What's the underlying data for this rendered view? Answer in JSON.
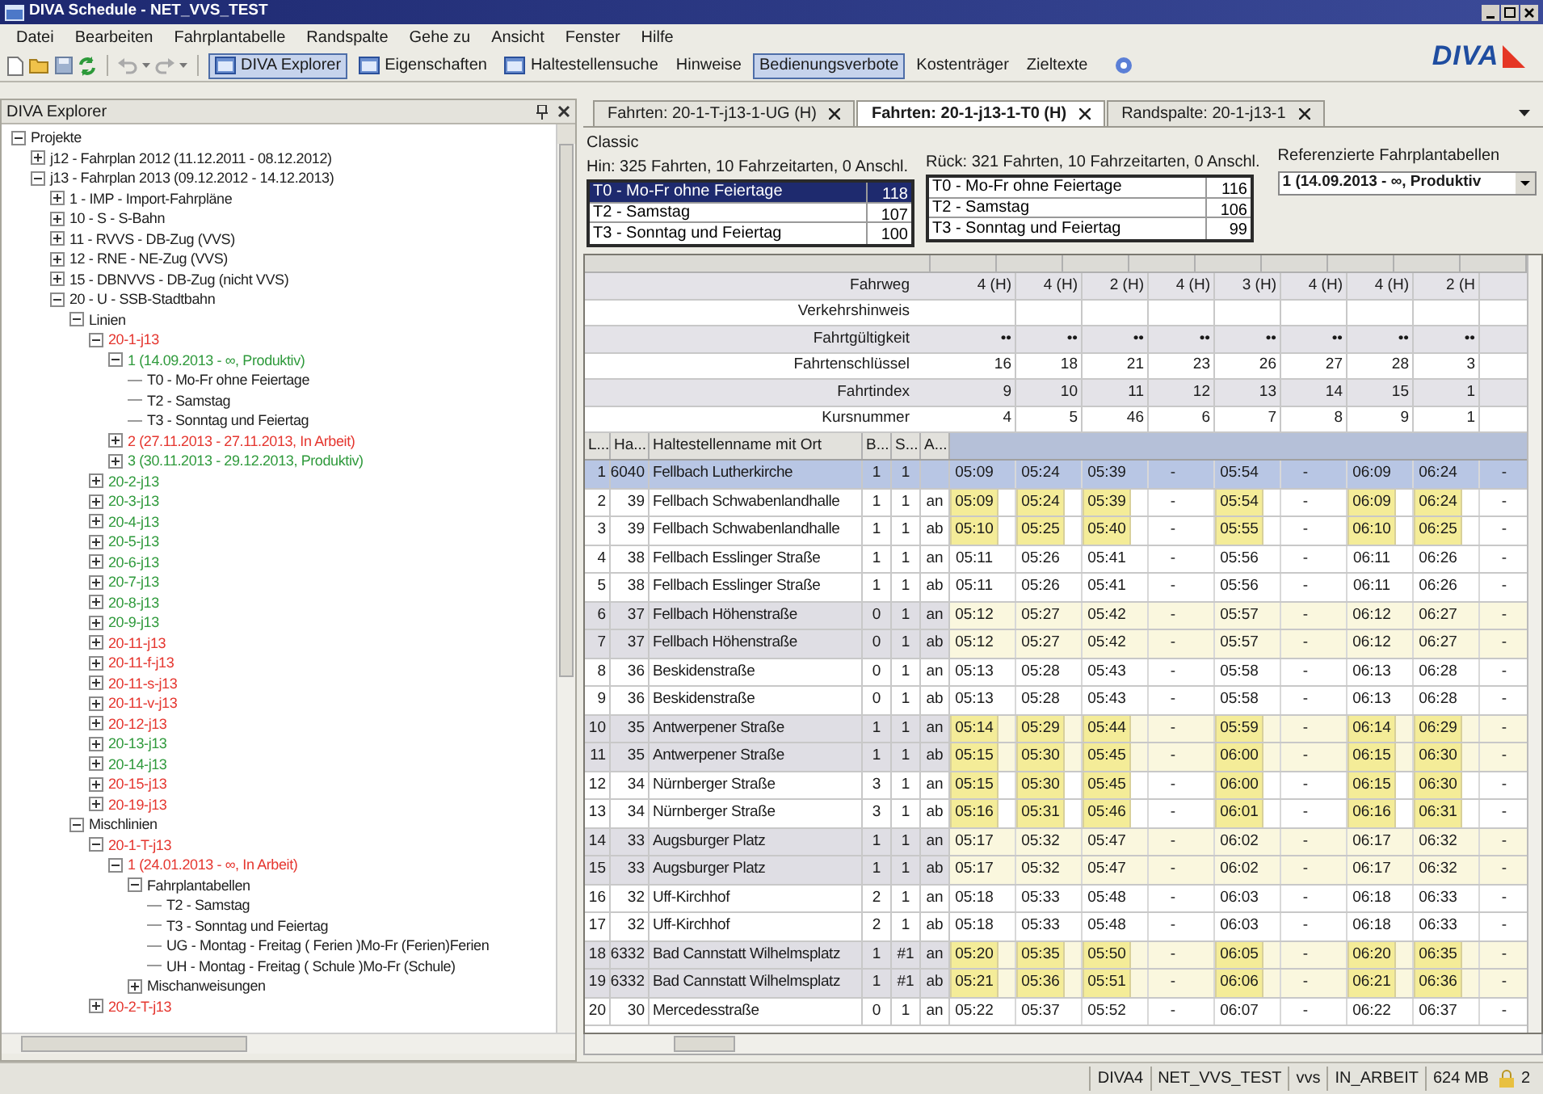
{
  "window": {
    "title": "DIVA Schedule - NET_VVS_TEST"
  },
  "menu": [
    "Datei",
    "Bearbeiten",
    "Fahrplantabelle",
    "Randspalte",
    "Gehe zu",
    "Ansicht",
    "Fenster",
    "Hilfe"
  ],
  "logo": {
    "text": "DIVA"
  },
  "toolbar": [
    {
      "label": "DIVA Explorer",
      "kind": "icon-text",
      "on": true
    },
    {
      "label": "Eigenschaften",
      "kind": "icon-text",
      "on": false
    },
    {
      "label": "Haltestellensuche",
      "kind": "icon-text",
      "on": false
    },
    {
      "label": "Hinweise",
      "kind": "text",
      "on": false
    },
    {
      "label": "Bedienungsverbote",
      "kind": "text",
      "on": true
    },
    {
      "label": "Kostenträger",
      "kind": "text",
      "on": false
    },
    {
      "label": "Zieltexte",
      "kind": "text",
      "on": false
    }
  ],
  "explorer": {
    "title": "DIVA Explorer",
    "tree": [
      {
        "label": "Projekte",
        "color": "#1e1e1e",
        "expanded": true,
        "children": [
          {
            "label": "j12 - Fahrplan 2012 (11.12.2011 - 08.12.2012)",
            "color": "#1e1e1e",
            "expanded": false
          },
          {
            "label": "j13 - Fahrplan 2013 (09.12.2012 - 14.12.2013)",
            "color": "#1e1e1e",
            "expanded": true,
            "children": [
              {
                "label": "1 - IMP - Import-Fahrpläne",
                "color": "#1e1e1e",
                "expanded": false
              },
              {
                "label": "10 - S - S-Bahn",
                "color": "#1e1e1e",
                "expanded": false
              },
              {
                "label": "11 - RVVS - DB-Zug  (VVS)",
                "color": "#1e1e1e",
                "expanded": false
              },
              {
                "label": "12 - RNE - NE-Zug (VVS)",
                "color": "#1e1e1e",
                "expanded": false
              },
              {
                "label": "15 - DBNVVS - DB-Zug  (nicht VVS)",
                "color": "#1e1e1e",
                "expanded": false
              },
              {
                "label": "20 - U - SSB-Stadtbahn",
                "color": "#1e1e1e",
                "expanded": true,
                "children": [
                  {
                    "label": "Linien",
                    "color": "#1e1e1e",
                    "expanded": true,
                    "children": [
                      {
                        "label": "20-1-j13",
                        "color": "#e5362f",
                        "expanded": true,
                        "children": [
                          {
                            "label": "1 (14.09.2013 - ∞, Produktiv)",
                            "color": "#2f9a3c",
                            "expanded": true,
                            "children": [
                              {
                                "label": "T0 - Mo-Fr ohne Feiertage",
                                "color": "#1e1e1e"
                              },
                              {
                                "label": "T2 - Samstag",
                                "color": "#1e1e1e"
                              },
                              {
                                "label": "T3 - Sonntag und Feiertag",
                                "color": "#1e1e1e"
                              }
                            ]
                          },
                          {
                            "label": "2 (27.11.2013 - 27.11.2013, In Arbeit)",
                            "color": "#e5362f",
                            "expanded": false
                          },
                          {
                            "label": "3 (30.11.2013 - 29.12.2013, Produktiv)",
                            "color": "#2f9a3c",
                            "expanded": false
                          }
                        ]
                      },
                      {
                        "label": "20-2-j13",
                        "color": "#2f9a3c",
                        "expanded": false
                      },
                      {
                        "label": "20-3-j13",
                        "color": "#2f9a3c",
                        "expanded": false
                      },
                      {
                        "label": "20-4-j13",
                        "color": "#2f9a3c",
                        "expanded": false
                      },
                      {
                        "label": "20-5-j13",
                        "color": "#2f9a3c",
                        "expanded": false
                      },
                      {
                        "label": "20-6-j13",
                        "color": "#2f9a3c",
                        "expanded": false
                      },
                      {
                        "label": "20-7-j13",
                        "color": "#2f9a3c",
                        "expanded": false
                      },
                      {
                        "label": "20-8-j13",
                        "color": "#2f9a3c",
                        "expanded": false
                      },
                      {
                        "label": "20-9-j13",
                        "color": "#2f9a3c",
                        "expanded": false
                      },
                      {
                        "label": "20-11-j13",
                        "color": "#e5362f",
                        "expanded": false
                      },
                      {
                        "label": "20-11-f-j13",
                        "color": "#e5362f",
                        "expanded": false
                      },
                      {
                        "label": "20-11-s-j13",
                        "color": "#e5362f",
                        "expanded": false
                      },
                      {
                        "label": "20-11-v-j13",
                        "color": "#e5362f",
                        "expanded": false
                      },
                      {
                        "label": "20-12-j13",
                        "color": "#e5362f",
                        "expanded": false
                      },
                      {
                        "label": "20-13-j13",
                        "color": "#2f9a3c",
                        "expanded": false
                      },
                      {
                        "label": "20-14-j13",
                        "color": "#2f9a3c",
                        "expanded": false
                      },
                      {
                        "label": "20-15-j13",
                        "color": "#e5362f",
                        "expanded": false
                      },
                      {
                        "label": "20-19-j13",
                        "color": "#e5362f",
                        "expanded": false
                      }
                    ]
                  },
                  {
                    "label": "Mischlinien",
                    "color": "#1e1e1e",
                    "expanded": true,
                    "children": [
                      {
                        "label": "20-1-T-j13",
                        "color": "#e5362f",
                        "expanded": true,
                        "children": [
                          {
                            "label": "1 (24.01.2013 - ∞, In Arbeit)",
                            "color": "#e5362f",
                            "expanded": true,
                            "children": [
                              {
                                "label": "Fahrplantabellen",
                                "color": "#1e1e1e",
                                "expanded": true,
                                "children": [
                                  {
                                    "label": "T2 - Samstag",
                                    "color": "#1e1e1e"
                                  },
                                  {
                                    "label": "T3 - Sonntag und Feiertag",
                                    "color": "#1e1e1e"
                                  },
                                  {
                                    "label": "UG - Montag - Freitag ( Ferien )Mo-Fr (Ferien)Ferien",
                                    "color": "#1e1e1e"
                                  },
                                  {
                                    "label": "UH - Montag - Freitag ( Schule )Mo-Fr (Schule)",
                                    "color": "#1e1e1e"
                                  }
                                ]
                              },
                              {
                                "label": "Mischanweisungen",
                                "color": "#1e1e1e",
                                "expanded": false
                              }
                            ]
                          }
                        ]
                      },
                      {
                        "label": "20-2-T-j13",
                        "color": "#e5362f",
                        "expanded": false
                      }
                    ]
                  }
                ]
              }
            ]
          }
        ]
      }
    ]
  },
  "tabs": [
    {
      "label": "Fahrten: 20-1-T-j13-1-UG (H)",
      "selected": false
    },
    {
      "label": "Fahrten: 20-1-j13-1-T0 (H)",
      "selected": true
    },
    {
      "label": "Randspalte: 20-1-j13-1",
      "selected": false
    }
  ],
  "summary": {
    "title": "Classic",
    "hin": {
      "caption": "Hin: 325 Fahrten, 10 Fahrzeitarten, 0 Anschl.",
      "rows": [
        {
          "label": "T0 - Mo-Fr ohne Feiertage",
          "count": "118",
          "selected": true
        },
        {
          "label": "T2 - Samstag",
          "count": "107",
          "selected": false
        },
        {
          "label": "T3 - Sonntag und Feiertag",
          "count": "100",
          "selected": false
        }
      ]
    },
    "rueck": {
      "caption": "Rück: 321 Fahrten, 10 Fahrzeitarten, 0 Anschl.",
      "rows": [
        {
          "label": "T0 - Mo-Fr ohne Feiertage",
          "count": "116",
          "selected": false
        },
        {
          "label": "T2 - Samstag",
          "count": "106",
          "selected": false
        },
        {
          "label": "T3 - Sonntag und Feiertag",
          "count": "99",
          "selected": false
        }
      ]
    }
  },
  "reference": {
    "label": "Referenzierte Fahrplantabellen",
    "value": "1 (14.09.2013 - ∞, Produktiv"
  },
  "grid": {
    "columns": [
      {
        "highlight": true
      },
      {
        "highlight": true
      },
      {
        "highlight": true
      },
      {
        "highlight": false
      },
      {
        "highlight": true
      },
      {
        "highlight": false
      },
      {
        "highlight": true
      },
      {
        "highlight": true
      },
      {
        "highlight": false
      }
    ],
    "header_rows": [
      {
        "label": "Fahrweg",
        "values": [
          "4 (H)",
          "4 (H)",
          "2 (H)",
          "4 (H)",
          "3 (H)",
          "4 (H)",
          "4 (H)",
          "2 (H"
        ]
      },
      {
        "label": "Verkehrshinweis"
      },
      {
        "label": "Fahrtgültigkeit",
        "values": [
          "••",
          "••",
          "••",
          "••",
          "••",
          "••",
          "••",
          "••"
        ]
      },
      {
        "label": "Fahrtenschlüssel",
        "values": [
          "16",
          "18",
          "21",
          "23",
          "26",
          "27",
          "28",
          "3"
        ]
      },
      {
        "label": "Fahrtindex",
        "values": [
          "9",
          "10",
          "11",
          "12",
          "13",
          "14",
          "15",
          "1"
        ]
      },
      {
        "label": "Kursnummer",
        "values": [
          "4",
          "5",
          "46",
          "6",
          "7",
          "8",
          "9",
          "1"
        ]
      }
    ],
    "stop_columns": [
      "L...",
      "Ha...",
      "Haltestellenname mit Ort",
      "B...",
      "S...",
      "A..."
    ],
    "stops": [
      {
        "l": "1",
        "ha": "6040",
        "name": "Fellbach Lutherkirche",
        "b": "1",
        "s": "1",
        "times": [
          "05:09",
          "05:24",
          "05:39",
          "-",
          "05:54",
          "-",
          "06:09",
          "06:24",
          "-"
        ],
        "selected": true,
        "shaded": false,
        "highlighted": false
      },
      {
        "l": "2",
        "ha": "39",
        "name": "Fellbach Schwabenlandhalle",
        "b": "1",
        "s": "1",
        "a": "an",
        "times": [
          "05:09",
          "05:24",
          "05:39",
          "-",
          "05:54",
          "-",
          "06:09",
          "06:24",
          "-"
        ],
        "selected": false,
        "shaded": false,
        "highlighted": true
      },
      {
        "l": "3",
        "ha": "39",
        "name": "Fellbach Schwabenlandhalle",
        "b": "1",
        "s": "1",
        "a": "ab",
        "times": [
          "05:10",
          "05:25",
          "05:40",
          "-",
          "05:55",
          "-",
          "06:10",
          "06:25",
          "-"
        ],
        "selected": false,
        "shaded": false,
        "highlighted": true
      },
      {
        "l": "4",
        "ha": "38",
        "name": "Fellbach Esslinger Straße",
        "b": "1",
        "s": "1",
        "a": "an",
        "times": [
          "05:11",
          "05:26",
          "05:41",
          "-",
          "05:56",
          "-",
          "06:11",
          "06:26",
          "-"
        ],
        "selected": false,
        "shaded": false,
        "highlighted": false
      },
      {
        "l": "5",
        "ha": "38",
        "name": "Fellbach Esslinger Straße",
        "b": "1",
        "s": "1",
        "a": "ab",
        "times": [
          "05:11",
          "05:26",
          "05:41",
          "-",
          "05:56",
          "-",
          "06:11",
          "06:26",
          "-"
        ],
        "selected": false,
        "shaded": false,
        "highlighted": false
      },
      {
        "l": "6",
        "ha": "37",
        "name": "Fellbach Höhenstraße",
        "b": "0",
        "s": "1",
        "a": "an",
        "times": [
          "05:12",
          "05:27",
          "05:42",
          "-",
          "05:57",
          "-",
          "06:12",
          "06:27",
          "-"
        ],
        "selected": false,
        "shaded": true,
        "highlighted": false
      },
      {
        "l": "7",
        "ha": "37",
        "name": "Fellbach Höhenstraße",
        "b": "0",
        "s": "1",
        "a": "ab",
        "times": [
          "05:12",
          "05:27",
          "05:42",
          "-",
          "05:57",
          "-",
          "06:12",
          "06:27",
          "-"
        ],
        "selected": false,
        "shaded": true,
        "highlighted": false
      },
      {
        "l": "8",
        "ha": "36",
        "name": "Beskidenstraße",
        "b": "0",
        "s": "1",
        "a": "an",
        "times": [
          "05:13",
          "05:28",
          "05:43",
          "-",
          "05:58",
          "-",
          "06:13",
          "06:28",
          "-"
        ],
        "selected": false,
        "shaded": false,
        "highlighted": false
      },
      {
        "l": "9",
        "ha": "36",
        "name": "Beskidenstraße",
        "b": "0",
        "s": "1",
        "a": "ab",
        "times": [
          "05:13",
          "05:28",
          "05:43",
          "-",
          "05:58",
          "-",
          "06:13",
          "06:28",
          "-"
        ],
        "selected": false,
        "shaded": false,
        "highlighted": false
      },
      {
        "l": "10",
        "ha": "35",
        "name": "Antwerpener Straße",
        "b": "1",
        "s": "1",
        "a": "an",
        "times": [
          "05:14",
          "05:29",
          "05:44",
          "-",
          "05:59",
          "-",
          "06:14",
          "06:29",
          "-"
        ],
        "selected": false,
        "shaded": true,
        "highlighted": true
      },
      {
        "l": "11",
        "ha": "35",
        "name": "Antwerpener Straße",
        "b": "1",
        "s": "1",
        "a": "ab",
        "times": [
          "05:15",
          "05:30",
          "05:45",
          "-",
          "06:00",
          "-",
          "06:15",
          "06:30",
          "-"
        ],
        "selected": false,
        "shaded": true,
        "highlighted": true
      },
      {
        "l": "12",
        "ha": "34",
        "name": "Nürnberger Straße",
        "b": "3",
        "s": "1",
        "a": "an",
        "times": [
          "05:15",
          "05:30",
          "05:45",
          "-",
          "06:00",
          "-",
          "06:15",
          "06:30",
          "-"
        ],
        "selected": false,
        "shaded": false,
        "highlighted": true
      },
      {
        "l": "13",
        "ha": "34",
        "name": "Nürnberger Straße",
        "b": "3",
        "s": "1",
        "a": "ab",
        "times": [
          "05:16",
          "05:31",
          "05:46",
          "-",
          "06:01",
          "-",
          "06:16",
          "06:31",
          "-"
        ],
        "selected": false,
        "shaded": false,
        "highlighted": true
      },
      {
        "l": "14",
        "ha": "33",
        "name": "Augsburger Platz",
        "b": "1",
        "s": "1",
        "a": "an",
        "times": [
          "05:17",
          "05:32",
          "05:47",
          "-",
          "06:02",
          "-",
          "06:17",
          "06:32",
          "-"
        ],
        "selected": false,
        "shaded": true,
        "highlighted": false
      },
      {
        "l": "15",
        "ha": "33",
        "name": "Augsburger Platz",
        "b": "1",
        "s": "1",
        "a": "ab",
        "times": [
          "05:17",
          "05:32",
          "05:47",
          "-",
          "06:02",
          "-",
          "06:17",
          "06:32",
          "-"
        ],
        "selected": false,
        "shaded": true,
        "highlighted": false
      },
      {
        "l": "16",
        "ha": "32",
        "name": "Uff-Kirchhof",
        "b": "2",
        "s": "1",
        "a": "an",
        "times": [
          "05:18",
          "05:33",
          "05:48",
          "-",
          "06:03",
          "-",
          "06:18",
          "06:33",
          "-"
        ],
        "selected": false,
        "shaded": false,
        "highlighted": false
      },
      {
        "l": "17",
        "ha": "32",
        "name": "Uff-Kirchhof",
        "b": "2",
        "s": "1",
        "a": "ab",
        "times": [
          "05:18",
          "05:33",
          "05:48",
          "-",
          "06:03",
          "-",
          "06:18",
          "06:33",
          "-"
        ],
        "selected": false,
        "shaded": false,
        "highlighted": false
      },
      {
        "l": "18",
        "ha": "6332",
        "name": "Bad Cannstatt Wilhelmsplatz",
        "b": "1",
        "s": "#1",
        "a": "an",
        "times": [
          "05:20",
          "05:35",
          "05:50",
          "-",
          "06:05",
          "-",
          "06:20",
          "06:35",
          "-"
        ],
        "selected": false,
        "shaded": true,
        "highlighted": true
      },
      {
        "l": "19",
        "ha": "6332",
        "name": "Bad Cannstatt Wilhelmsplatz",
        "b": "1",
        "s": "#1",
        "a": "ab",
        "times": [
          "05:21",
          "05:36",
          "05:51",
          "-",
          "06:06",
          "-",
          "06:21",
          "06:36",
          "-"
        ],
        "selected": false,
        "shaded": true,
        "highlighted": true
      },
      {
        "l": "20",
        "ha": "30",
        "name": "Mercedesstraße",
        "b": "0",
        "s": "1",
        "a": "an",
        "times": [
          "05:22",
          "05:37",
          "05:52",
          "-",
          "06:07",
          "-",
          "06:22",
          "06:37",
          "-"
        ],
        "selected": false,
        "shaded": false,
        "highlighted": false
      }
    ]
  },
  "status_bar": {
    "items": [
      "DIVA4",
      "NET_VVS_TEST",
      "vvs",
      "IN_ARBEIT",
      "624 MB"
    ],
    "lock_count": "2"
  }
}
